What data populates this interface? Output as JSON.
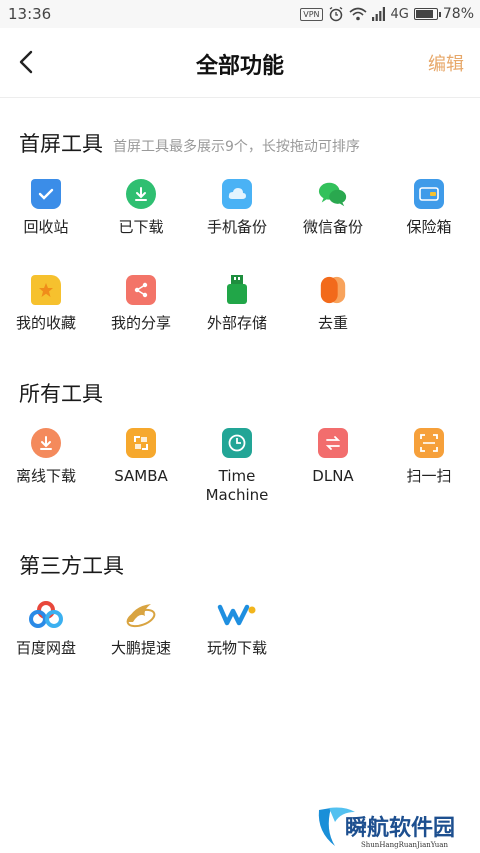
{
  "status_bar": {
    "time": "13:36",
    "vpn": "VPN",
    "network": "4G",
    "battery": "78%",
    "battery_level": 0.78
  },
  "header": {
    "title": "全部功能",
    "edit_label": "编辑"
  },
  "home_tools": {
    "title": "首屏工具",
    "hint": "首屏工具最多展示9个，长按拖动可排序",
    "items": [
      {
        "label": "回收站",
        "icon": "recycle-bin-icon",
        "color": "#3b8de8"
      },
      {
        "label": "已下载",
        "icon": "downloaded-icon",
        "color": "#2fbf71"
      },
      {
        "label": "手机备份",
        "icon": "phone-backup-icon",
        "color": "#4ab2f5"
      },
      {
        "label": "微信备份",
        "icon": "wechat-backup-icon",
        "color": "#33c15b"
      },
      {
        "label": "保险箱",
        "icon": "safe-box-icon",
        "color": "#3f9be9"
      },
      {
        "label": "我的收藏",
        "icon": "favorites-icon",
        "color": "#f6c12e"
      },
      {
        "label": "我的分享",
        "icon": "share-icon",
        "color": "#f37468"
      },
      {
        "label": "外部存储",
        "icon": "external-storage-icon",
        "color": "#21a648"
      },
      {
        "label": "去重",
        "icon": "dedupe-icon",
        "color": "#f47a24"
      }
    ]
  },
  "all_tools": {
    "title": "所有工具",
    "items": [
      {
        "label": "离线下载",
        "icon": "offline-download-icon",
        "color": "#f48a5c"
      },
      {
        "label": "SAMBA",
        "icon": "samba-icon",
        "color": "#f6a82d"
      },
      {
        "label": "Time Machine",
        "label_line1": "Time",
        "label_line2": "Machine",
        "icon": "time-machine-icon",
        "color": "#22a596"
      },
      {
        "label": "DLNA",
        "icon": "dlna-icon",
        "color": "#f26d6d"
      },
      {
        "label": "扫一扫",
        "icon": "scan-icon",
        "color": "#f6a03a"
      }
    ]
  },
  "third_party_tools": {
    "title": "第三方工具",
    "items": [
      {
        "label": "百度网盘",
        "icon": "baidu-netdisk-icon",
        "color": "#2a8ae6"
      },
      {
        "label": "大鹏提速",
        "icon": "dapeng-speedup-icon",
        "color": "#d9a441"
      },
      {
        "label": "玩物下载",
        "icon": "wanwu-download-icon",
        "color": "#1f8fe0"
      }
    ]
  },
  "watermark": {
    "text": "瞬航软件园",
    "subtext": "ShunHangRuanJianYuan"
  }
}
